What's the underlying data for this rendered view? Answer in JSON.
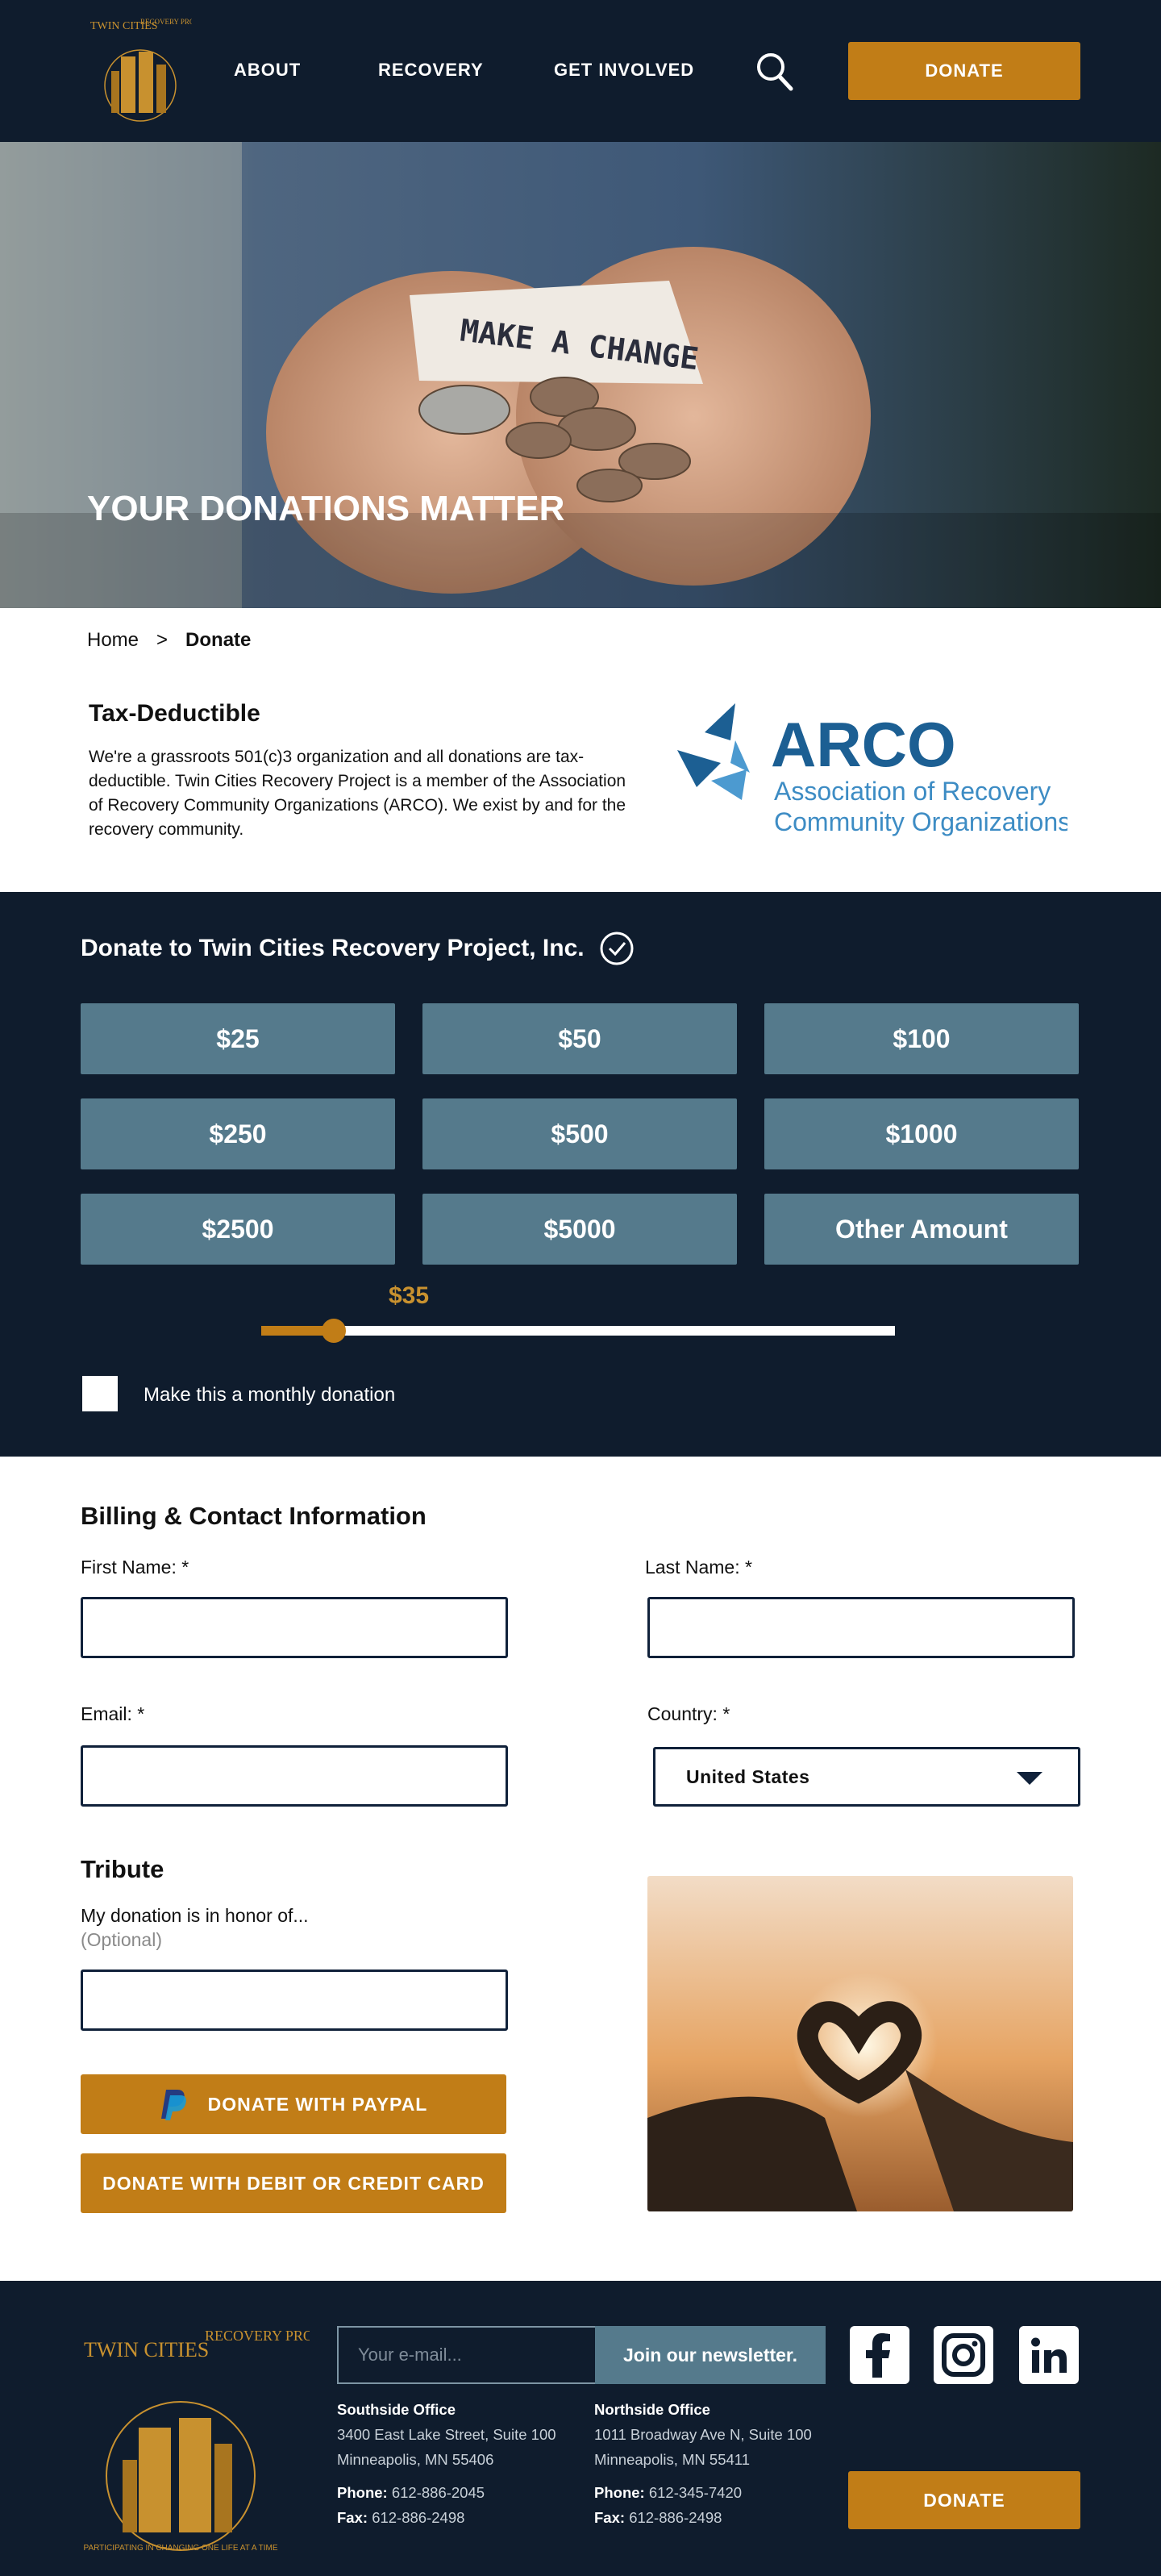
{
  "header": {
    "logo_lines": [
      "TWIN CITIES",
      "RECOVERY PROJECT INC."
    ],
    "nav": [
      "ABOUT",
      "RECOVERY",
      "GET INVOLVED"
    ],
    "donate": "DONATE"
  },
  "hero": {
    "note_text": "MAKE A CHANGE",
    "title": "YOUR DONATIONS MATTER"
  },
  "breadcrumb": {
    "home": "Home",
    "sep": ">",
    "current": "Donate"
  },
  "tax": {
    "title": "Tax-Deductible",
    "body": "We're a grassroots 501(c)3 organization and all donations are tax-deductible. Twin Cities Recovery Project is a member of the Association of Recovery Community Organizations (ARCO). We exist by and for the recovery community."
  },
  "arco": {
    "name": "ARCO",
    "line1": "Association of Recovery",
    "line2": "Community Organizations"
  },
  "donate": {
    "title": "Donate to Twin Cities Recovery Project, Inc.",
    "amounts": [
      "$25",
      "$50",
      "$100",
      "$250",
      "$500",
      "$1000",
      "$2500",
      "$5000",
      "Other Amount"
    ],
    "slider_value": "$35",
    "slider_fraction": 0.115,
    "monthly_label": "Make this a monthly donation"
  },
  "billing": {
    "title": "Billing & Contact Information",
    "first_name": "First Name: *",
    "last_name": "Last Name: *",
    "email": "Email: *",
    "country": "Country: *",
    "country_value": "United States"
  },
  "tribute": {
    "title": "Tribute",
    "honor": "My donation is in honor of...",
    "optional": "(Optional)"
  },
  "buttons": {
    "paypal": "DONATE WITH PAYPAL",
    "card": "DONATE WITH DEBIT OR CREDIT CARD"
  },
  "footer": {
    "newsletter_placeholder": "Your e-mail...",
    "newsletter_button": "Join our newsletter.",
    "south": {
      "title": "Southside Office",
      "addr1": "3400 East Lake Street, Suite 100",
      "addr2": "Minneapolis, MN 55406",
      "phone_label": "Phone:",
      "phone": "612-886-2045",
      "fax_label": "Fax:",
      "fax": "612-886-2498"
    },
    "north": {
      "title": "Northside Office",
      "addr1": "1011 Broadway Ave N, Suite 100",
      "addr2": "Minneapolis, MN 55411",
      "phone_label": "Phone:",
      "phone": "612-345-7420",
      "fax_label": "Fax:",
      "fax": "612-886-2498"
    },
    "donate": "DONATE",
    "logo_tagline": "PARTICIPATING IN CHANGING ONE LIFE AT A TIME"
  },
  "colors": {
    "navy": "#0f1c2d",
    "gold": "#c17d17",
    "slate": "#557a8c"
  }
}
